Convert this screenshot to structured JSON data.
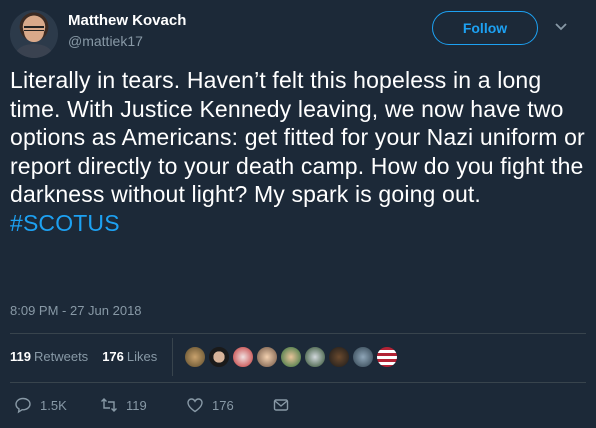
{
  "author": {
    "name": "Matthew Kovach",
    "handle": "@mattiek17"
  },
  "follow_label": "Follow",
  "tweet": {
    "text": "Literally in tears. Haven’t felt this hopeless in a long time. With Justice Kennedy leaving, we now have two options as Americans: get fitted for your Nazi uniform or report directly to your death camp. How do you fight the darkness without light? My spark is going out.",
    "hashtag": "#SCOTUS",
    "timestamp": "8:09 PM - 27 Jun 2018"
  },
  "stats": {
    "retweets_count": "119",
    "retweets_label": "Retweets",
    "likes_count": "176",
    "likes_label": "Likes"
  },
  "actions": {
    "reply_count": "1.5K",
    "retweet_count": "119",
    "like_count": "176"
  },
  "colors": {
    "background": "#1c2938",
    "accent": "#1da1f2",
    "muted": "#8899a6",
    "divider": "#38444d"
  }
}
